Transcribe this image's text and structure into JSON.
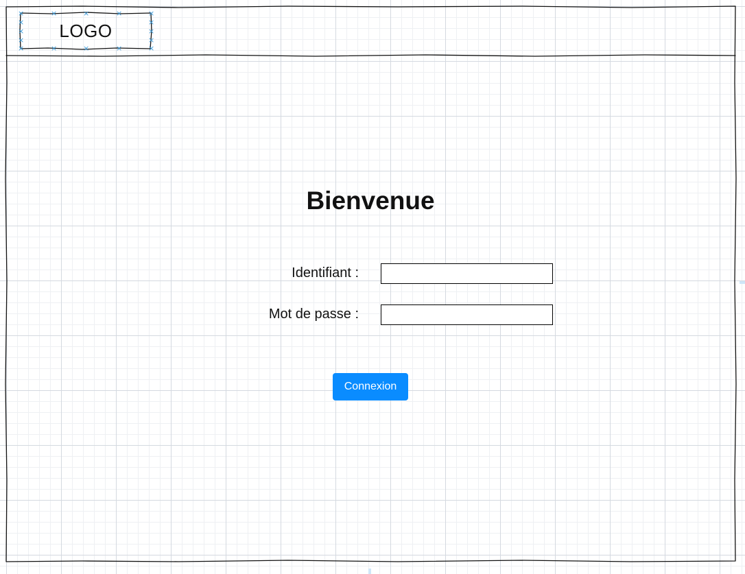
{
  "header": {
    "logo_text": "LOGO"
  },
  "main": {
    "title": "Bienvenue",
    "fields": [
      {
        "label": "Identifiant :",
        "value": "",
        "placeholder": ""
      },
      {
        "label": "Mot de passe :",
        "value": "",
        "placeholder": ""
      }
    ],
    "submit_label": "Connexion"
  },
  "colors": {
    "accent": "#0a8cff",
    "selection_handles": "#3a9ad9",
    "grid_major": "#d4d9e0",
    "grid_minor": "#eef0f3"
  }
}
